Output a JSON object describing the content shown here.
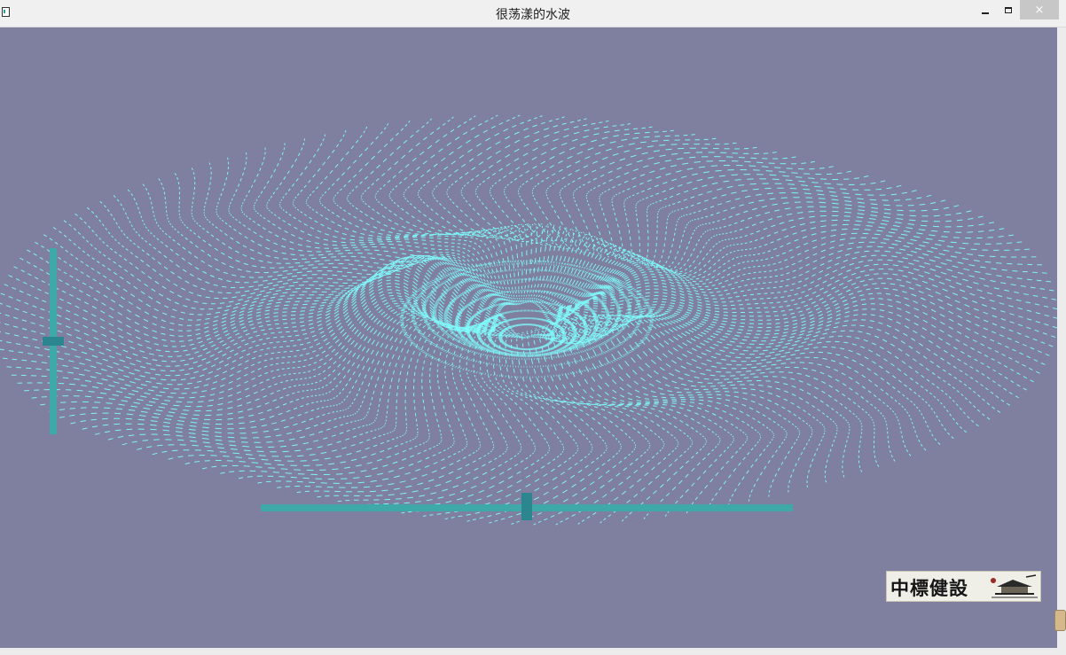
{
  "window": {
    "title": "很荡漾的水波",
    "minimize_glyph": "minimize-icon",
    "maximize_glyph": "maximize-icon",
    "close_glyph": "×"
  },
  "scene": {
    "background": "#7f7f9f",
    "wave_color": "#7fffff",
    "track_color": "#3fa8a8",
    "thumb_color": "#2b8690"
  },
  "sliders": {
    "vertical": {
      "value": 0.5
    },
    "horizontal": {
      "value": 0.5
    }
  },
  "logo": {
    "text": "中標健設"
  }
}
